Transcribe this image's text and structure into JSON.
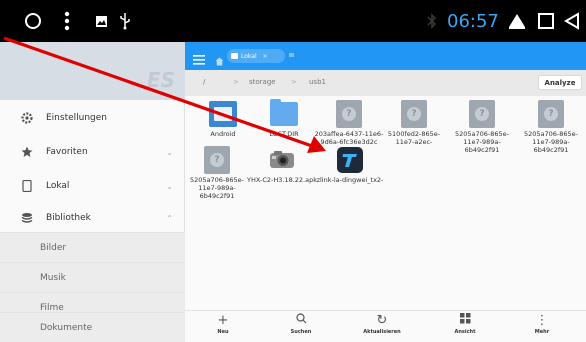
{
  "statusbar": {
    "time": "06:57",
    "icons": [
      "circle-home-icon",
      "overflow-dots-icon",
      "image-icon",
      "usb-icon",
      "bluetooth-icon",
      "wifi-triangle-icon",
      "square-recents-icon",
      "back-triangle-icon"
    ]
  },
  "topbar": {
    "menu_icon": "hamburger-icon",
    "home_icon": "home-icon",
    "tab_label": "Lokal",
    "accent": "#2196f3"
  },
  "drawer": {
    "logo": "ES",
    "items": [
      {
        "label": "Einstellungen",
        "icon": "gear-icon"
      },
      {
        "label": "Favoriten",
        "icon": "star-icon"
      },
      {
        "label": "Lokal",
        "icon": "phone-icon"
      },
      {
        "label": "Bibliothek",
        "icon": "stack-icon"
      }
    ],
    "subitems": [
      "Bilder",
      "Musik",
      "Filme",
      "Dokumente"
    ]
  },
  "path": {
    "root": "/",
    "segments": [
      "storage",
      "usb1"
    ],
    "analyze": "Analyze"
  },
  "files": [
    {
      "name": "Android",
      "type": "folder-image"
    },
    {
      "name": "LOST.DIR",
      "type": "folder"
    },
    {
      "name": "203affea-6437-11e6-9d6a-6fc36e3d2c",
      "type": "unknown"
    },
    {
      "name": "5100fed2-865e-11e7-a2ec-",
      "type": "unknown"
    },
    {
      "name": "5205a706-865e-11e7-989a-6b49c2f91",
      "type": "unknown"
    },
    {
      "name": "5205a706-865e-11e7-989a-6b49c2f91",
      "type": "unknown"
    },
    {
      "name": "5205a706-865e-11e7-989a-6b49c2f91",
      "type": "unknown"
    },
    {
      "name": "YHX-C2-H3.18.22.apk",
      "type": "apk"
    },
    {
      "name": "zlink-la-dingwei_tx2-",
      "type": "zlink"
    }
  ],
  "toolbar": [
    {
      "label": "Neu",
      "icon": "plus-icon"
    },
    {
      "label": "Suchen",
      "icon": "search-icon"
    },
    {
      "label": "Aktualisieren",
      "icon": "refresh-icon"
    },
    {
      "label": "Ansicht",
      "icon": "grid-view-icon"
    },
    {
      "label": "Mehr",
      "icon": "more-vert-icon"
    }
  ],
  "annotation": {
    "color": "#e00000"
  }
}
